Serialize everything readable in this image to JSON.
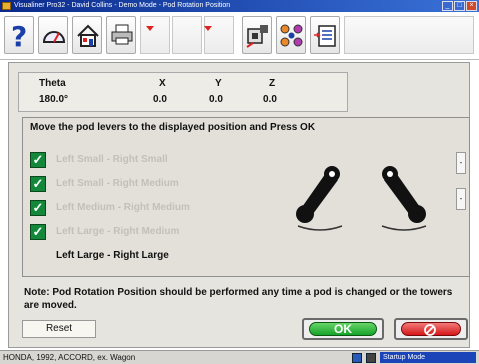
{
  "window": {
    "title": "Visualiner Pro32 - David Collins - Demo Mode - Pod Rotation Position",
    "buttons": [
      "minimize-icon",
      "maximize-icon",
      "close-icon"
    ]
  },
  "toolbar": {
    "buttons": [
      {
        "name": "help-button",
        "icon": "question-mark-icon",
        "glyph": "?"
      },
      {
        "name": "gauge-button",
        "icon": "gauge-icon"
      },
      {
        "name": "home-button",
        "icon": "home-icon"
      },
      {
        "name": "print-button",
        "icon": "printer-icon"
      },
      {
        "name": "pod-button",
        "icon": "pod-alignment-icon"
      },
      {
        "name": "tire-button",
        "icon": "tire-grid-icon"
      },
      {
        "name": "report-button",
        "icon": "clipboard-icon"
      }
    ]
  },
  "coords": {
    "headers": {
      "theta": "Theta",
      "x": "X",
      "y": "Y",
      "z": "Z"
    },
    "values": {
      "theta": "180.0°",
      "x": "0.0",
      "y": "0.0",
      "z": "0.0"
    }
  },
  "instructions": "Move the pod levers to the displayed position and Press OK",
  "options": [
    {
      "label": "Left Small - Right Small",
      "checked": true
    },
    {
      "label": "Left Small - Right Medium",
      "checked": true
    },
    {
      "label": "Left Medium - Right Medium",
      "checked": true
    },
    {
      "label": "Left Large - Right Medium",
      "checked": true
    },
    {
      "label": "Left Large - Right Large",
      "checked": false
    }
  ],
  "check_glyph": "✓",
  "note": "Note: Pod Rotation Position should be performed any time a pod is changed or the towers are moved.",
  "buttons": {
    "reset": "Reset",
    "ok": "OK",
    "cancel_icon": "no-entry-icon"
  },
  "status": {
    "vehicle": "HONDA, 1992, ACCORD, ex. Wagon",
    "mode": "Startup Mode"
  },
  "colors": {
    "title_bar": "#0a2a8c",
    "ok_green": "#16a42a",
    "cancel_red": "#d41818",
    "checkbox_green": "#14883a",
    "status_mode_blue": "#1a44b8"
  }
}
